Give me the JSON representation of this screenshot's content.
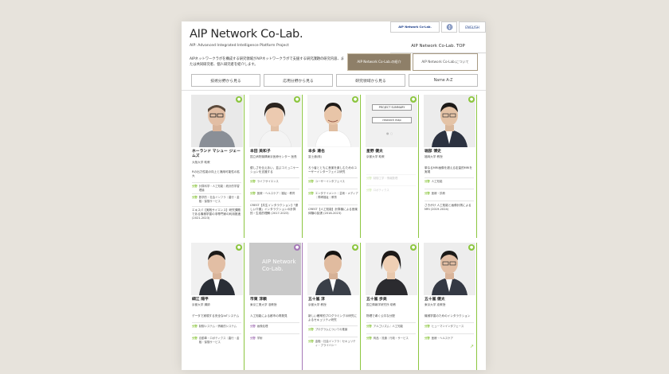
{
  "header": {
    "logo": "AIP Network Co-Lab.",
    "subtitle": "AIP: Advanced Integrated Intelligence Platform Project",
    "mini_logo": "AIP Network Co-Lab.",
    "lang_label": "ENGLISH",
    "top_link": "AIP Network Co-Lab.  TOP",
    "description": "AIPネットワークラボを構成する研究領域がAIPネットワークラボで支援する研究課題の研究内容、または共同研究者、個人研究者を紹介します。",
    "btn_dark": "AIP Network Co-Lab.の紹介",
    "btn_light": "AIP Network Co-Lab.について"
  },
  "tabs": [
    "技術分野から見る",
    "応用分野から見る",
    "研究領域から見る",
    "Name A-Z"
  ],
  "icons": {
    "corner": "people-icon",
    "external": "external-link-icon",
    "arrow": "arrow-right-icon"
  },
  "colors": {
    "green": "#8cc63f",
    "purple": "#a678b8",
    "brown": "#8e7f68"
  },
  "cards_row1": [
    {
      "name": "ホーランド マシュー ジェームズ",
      "aff": "大阪大学 助教",
      "desc": "Rの出力性能の向上と適用可能性の拡大",
      "tags": [
        {
          "k": "分野",
          "v": "計算科学・人工知能｜統計的学習理論"
        },
        {
          "k": "分野",
          "v": "数学的・社会インフラ｜農行・金融・保険サービス"
        }
      ],
      "extra": "エキスパ【実践サイエンス】研究課題である機械学習の非専門家の利用推進 (2021-2023)"
    },
    {
      "name": "本田 美和子",
      "aff": "国立病院機構東京医療センター 医長",
      "desc": "優しさを伝えあい、並ぶコミュニケーションを支援する",
      "tags": [
        {
          "k": "分野",
          "v": "ライフサイエンス"
        },
        {
          "k": "分野",
          "v": "医療・ヘルスケア｜福祉・教育"
        }
      ],
      "extra": "CREST【共生インタラクション】「優しい介護」インタラクションの計算的・生成的理解 (2017-2023)"
    },
    {
      "name": "本多 達也",
      "aff": "富士通(株)",
      "desc": "ろう者とともに音楽を楽しむためのユーザーインターフェイス研究",
      "tags": [
        {
          "k": "分野",
          "v": "ユーザーインタフェイス"
        },
        {
          "k": "分野",
          "v": "エンタテイメント｜芸術・メディア｜障碍福祉｜教育"
        }
      ],
      "extra": "CREST【人工知能】計算機による音楽体験の拡張 (2018-2023)"
    },
    {
      "name": "星野 健太",
      "aff": "京都大学 助教",
      "desc": "",
      "tags": [
        {
          "k": "分野",
          "v": "制御工学・情報数理"
        },
        {
          "k": "分野",
          "v": "ロボティクス"
        }
      ],
      "extra": "",
      "promo": [
        "PROJECT SUMMARY",
        "research map"
      ]
    },
    {
      "name": "堀部 博史",
      "aff": "福岡大学 教授",
      "desc": "単なるMRI画像を超える定量的MRIを実現",
      "tags": [
        {
          "k": "分野",
          "v": "人工知能"
        },
        {
          "k": "分野",
          "v": "医療・診療"
        }
      ],
      "extra": "さきがけ 人工知能と画像計測による MRI (2019-2024)"
    }
  ],
  "cards_row2": [
    {
      "name": "細江 陽平",
      "aff": "京都大学 講師",
      "desc": "データで実現する安全なIoTシステム",
      "tags": [
        {
          "k": "分野",
          "v": "制御システム・情報的システム"
        },
        {
          "k": "分野",
          "v": "自動車・ロボティクス｜農行・金融・保険サービス"
        }
      ]
    },
    {
      "name": "市東 淳頼",
      "aff": "東京工業大学 准教授",
      "desc": "人工知能による都市の再発見",
      "tags": [
        {
          "k": "分野",
          "v": "画像処理"
        },
        {
          "k": "分野",
          "v": "学術"
        }
      ]
    },
    {
      "name": "五十嵐 淳",
      "aff": "京都大学 教授",
      "desc": "新しい確率的プログラミングの研究によるセキュリティ研究",
      "tags": [
        {
          "k": "分野",
          "v": "プログラムについての推論"
        },
        {
          "k": "分野",
          "v": "金融・社会インフラ｜セキュリティ・プライバシー"
        }
      ]
    },
    {
      "name": "五十嵐 歩美",
      "aff": "国立情報学研究所 助教",
      "desc": "物理で導く公平な分配",
      "tags": [
        {
          "k": "分野",
          "v": "アルゴリズム｜人工知能"
        },
        {
          "k": "分野",
          "v": "商品・流通｜行政・サービス"
        }
      ]
    },
    {
      "name": "五十嵐 健太",
      "aff": "東京大学 准教授",
      "desc": "機械学習のためのインタラクション",
      "tags": [
        {
          "k": "分野",
          "v": "ヒューマンインタフェース"
        },
        {
          "k": "分野",
          "v": "医療・ヘルスケア"
        }
      ]
    }
  ]
}
